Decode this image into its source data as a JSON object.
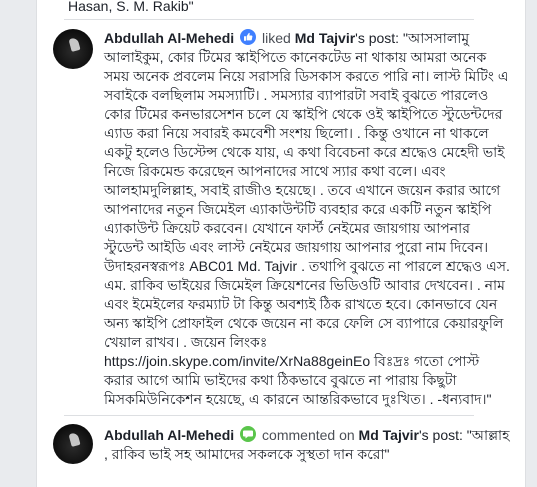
{
  "top_snippet": "Hasan, S. M. Rakib\"",
  "activity": [
    {
      "user": "Abdullah Al-Mehedi",
      "action_icon": "like-icon",
      "action": "liked",
      "target": "Md Tajvir",
      "suffix": "'s post:",
      "text": "\"আসসালামু আলাইকুম, কোর টিমের স্কাইপিতে কানেকটেড না থাকায় আমরা অনেক সময় অনেক প্রবলেম নিয়ে সরাসরি ডিসকাস করতে পারি না। লাস্ট মিটিং এ সবাইকে বলছিলাম সমস্যাটি। . সমস্যার ব্যাপারটা সবাই বুঝতে পারলেও কোর টিমের কনভারসেশন চলে যে স্কাইপি থেকে ওই স্কাইপিতে স্টুডেন্টদের এ্যাড করা নিয়ে সবারই কমবেশী সংশয় ছিলো। . কিন্তু ওখানে না থাকলে একটু হলেও ডিস্টেন্স থেকে যায়, এ কথা বিবেচনা করে শ্রদ্ধেও মেহেদী ভাই নিজে রিকমেন্ড করেছেন আপনাদের সাথে স্যার কথা বলে। এবং আলহামদুলিল্লাহ, সবাই রাজীও হয়েছে। . তবে এখানে জয়েন করার আগে আপনাদের নতুন জিমেইল এ্যাকাউন্টটি ব্যবহার করে একটি নতুন স্কাইপি এ্যাকাউন্ট ক্রিয়েট করবেন। যেখানে ফার্স্ট নেইমের জায়গায় আপনার স্টুডেন্ট আইডি এবং লাস্ট নেইমের জায়গায় আপনার পুরো নাম দিবেন। উদাহরনস্বরূপঃ ABC01 Md. Tajvir . তথাপি বুঝতে না পারলে শ্রদ্ধেও এস. এম. রাকিব ভাইয়ের জিমেইল ক্রিয়েশনের ভিডিওটি আবার দেখবেন। . নাম এবং ইমেইলের ফরম্যাট টা কিন্তু অবশ্যই ঠিক রাখতে হবে। কোনভাবে যেন অন্য স্কাইপি প্রোফাইল থেকে জয়েন না করে ফেলি সে ব্যাপারে কেয়ারফুলি খেয়াল রাখব। . জয়েন লিংকঃ",
      "link": "https://join.skype.com/invite/XrNa88geinEo",
      "text_after": " বিঃদ্রঃ গতো পোস্ট করার আগে আমি ভাইদের কথা ঠিকভাবে বুঝতে না পারায় কিছুটা মিসকমিউনিকেশন হয়েছে, এ কারনে আন্তরিকভাবে দুঃখিত। . -ধন্যবাদ।\""
    },
    {
      "user": "Abdullah Al-Mehedi",
      "action_icon": "comment-icon",
      "action": "commented on",
      "target": "Md Tajvir",
      "suffix": "'s post:",
      "text": "\"আল্লাহ , রাকিব ভাই সহ আমাদের সকলকে সুস্থতা দান করো\""
    }
  ],
  "colors": {
    "like_badge": "#4080ff",
    "comment_badge": "#5ac54b",
    "page_bg": "#e9ebee",
    "panel_bg": "#ffffff"
  }
}
